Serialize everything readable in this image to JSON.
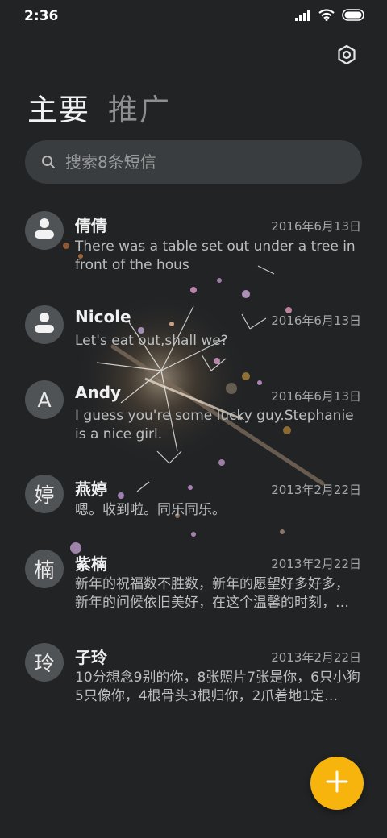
{
  "status_bar": {
    "time": "2:36",
    "icons": [
      "signal-icon",
      "wifi-icon",
      "battery-icon"
    ]
  },
  "settings_icon": "settings-icon",
  "tabs": [
    {
      "label": "主要",
      "active": true
    },
    {
      "label": "推广",
      "active": false
    }
  ],
  "search": {
    "placeholder": "搜索8条短信",
    "icon": "search-icon"
  },
  "conversations": [
    {
      "avatar": "",
      "avatar_icon": "person-icon",
      "name": "倩倩",
      "date": "2016年6月13日",
      "preview": "There was a table set out under a tree in front of the hous"
    },
    {
      "avatar": "",
      "avatar_icon": "person-icon",
      "name": "Nicole",
      "date": "2016年6月13日",
      "preview": "Let's eat out,shall we?"
    },
    {
      "avatar": "A",
      "name": "Andy",
      "date": "2016年6月13日",
      "preview": "I guess you're some lucky guy.Stephanie is a nice girl."
    },
    {
      "avatar": "婷",
      "name": "燕婷",
      "date": "2013年2月22日",
      "preview": "嗯。收到啦。同乐同乐。"
    },
    {
      "avatar": "楠",
      "name": "紫楠",
      "date": "2013年2月22日",
      "preview": "新年的祝福数不胜数，新年的愿望好多好多，新年的问候依旧美好，在这个温馨的时刻，…"
    },
    {
      "avatar": "玲",
      "name": "子玲",
      "date": "2013年2月22日",
      "preview": "10分想念9别的你，8张照片7张是你，6只小狗5只像你，4根骨头3根归你，2爪着地1定…"
    }
  ],
  "fab": {
    "icon": "plus-icon",
    "color": "#f6b40c"
  },
  "colors": {
    "background": "#212325",
    "accent": "#f6b40c"
  }
}
